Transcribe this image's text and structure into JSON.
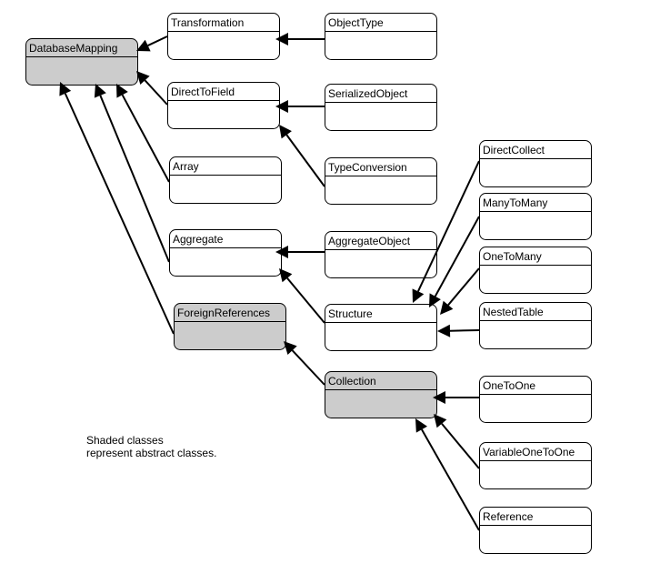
{
  "colors": {
    "abstract_fill": "#cccccc",
    "concrete_fill": "#ffffff",
    "line": "#000000"
  },
  "classes": [
    {
      "id": "DatabaseMapping",
      "label": "DatabaseMapping",
      "abstract": true
    },
    {
      "id": "Transformation",
      "label": "Transformation",
      "abstract": false
    },
    {
      "id": "ObjectType",
      "label": "ObjectType",
      "abstract": false
    },
    {
      "id": "DirectToField",
      "label": "DirectToField",
      "abstract": false
    },
    {
      "id": "SerializedObject",
      "label": "SerializedObject",
      "abstract": false
    },
    {
      "id": "Array",
      "label": "Array",
      "abstract": false
    },
    {
      "id": "TypeConversion",
      "label": "TypeConversion",
      "abstract": false
    },
    {
      "id": "Aggregate",
      "label": "Aggregate",
      "abstract": false
    },
    {
      "id": "AggregateObject",
      "label": "AggregateObject",
      "abstract": false
    },
    {
      "id": "ForeignReferences",
      "label": "ForeignReferences",
      "abstract": true
    },
    {
      "id": "Structure",
      "label": "Structure",
      "abstract": false
    },
    {
      "id": "Collection",
      "label": "Collection",
      "abstract": true
    },
    {
      "id": "DirectCollect",
      "label": "DirectCollect",
      "abstract": false
    },
    {
      "id": "ManyToMany",
      "label": "ManyToMany",
      "abstract": false
    },
    {
      "id": "OneToMany",
      "label": "OneToMany",
      "abstract": false
    },
    {
      "id": "NestedTable",
      "label": "NestedTable",
      "abstract": false
    },
    {
      "id": "OneToOne",
      "label": "OneToOne",
      "abstract": false
    },
    {
      "id": "VariableOneToOne",
      "label": "VariableOneToOne",
      "abstract": false
    },
    {
      "id": "Reference",
      "label": "Reference",
      "abstract": false
    }
  ],
  "inheritance": [
    {
      "child": "Transformation",
      "parent": "DatabaseMapping"
    },
    {
      "child": "ObjectType",
      "parent": "Transformation"
    },
    {
      "child": "DirectToField",
      "parent": "DatabaseMapping"
    },
    {
      "child": "SerializedObject",
      "parent": "DirectToField"
    },
    {
      "child": "TypeConversion",
      "parent": "DirectToField"
    },
    {
      "child": "Array",
      "parent": "DatabaseMapping"
    },
    {
      "child": "Aggregate",
      "parent": "DatabaseMapping"
    },
    {
      "child": "AggregateObject",
      "parent": "Aggregate"
    },
    {
      "child": "Structure",
      "parent": "Aggregate"
    },
    {
      "child": "ForeignReferences",
      "parent": "DatabaseMapping"
    },
    {
      "child": "Collection",
      "parent": "ForeignReferences"
    },
    {
      "child": "DirectCollect",
      "parent": "Structure"
    },
    {
      "child": "ManyToMany",
      "parent": "Structure"
    },
    {
      "child": "OneToMany",
      "parent": "Structure"
    },
    {
      "child": "NestedTable",
      "parent": "Structure"
    },
    {
      "child": "OneToOne",
      "parent": "Collection"
    },
    {
      "child": "VariableOneToOne",
      "parent": "Collection"
    },
    {
      "child": "Reference",
      "parent": "Collection"
    }
  ],
  "note": {
    "line1": "Shaded classes",
    "line2": "represent abstract classes."
  }
}
